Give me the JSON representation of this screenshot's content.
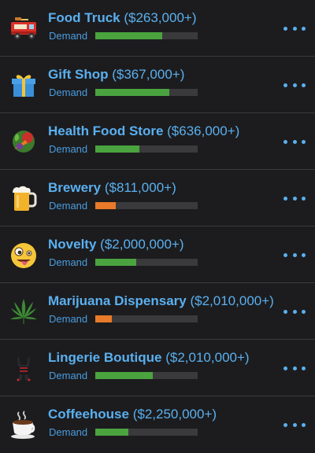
{
  "colors": {
    "accent": "#5ab0f0",
    "demand_high": "#4aa33f",
    "demand_low": "#e87a2a",
    "bar_track": "#3a3a3c"
  },
  "businesses": [
    {
      "name": "Food Truck",
      "price": "($263,000+)",
      "demand_label": "Demand",
      "demand": 0.65,
      "demand_color": "#4aa33f",
      "icon": "food-truck-icon"
    },
    {
      "name": "Gift Shop",
      "price": "($367,000+)",
      "demand_label": "Demand",
      "demand": 0.72,
      "demand_color": "#4aa33f",
      "icon": "gift-icon"
    },
    {
      "name": "Health Food Store",
      "price": "($636,000+)",
      "demand_label": "Demand",
      "demand": 0.43,
      "demand_color": "#4aa33f",
      "icon": "vegetables-icon"
    },
    {
      "name": "Brewery",
      "price": "($811,000+)",
      "demand_label": "Demand",
      "demand": 0.2,
      "demand_color": "#e87a2a",
      "icon": "beer-mug-icon"
    },
    {
      "name": "Novelty",
      "price": "($2,000,000+)",
      "demand_label": "Demand",
      "demand": 0.4,
      "demand_color": "#4aa33f",
      "icon": "zany-face-icon"
    },
    {
      "name": "Marijuana Dispensary",
      "price": "($2,010,000+)",
      "demand_label": "Demand",
      "demand": 0.16,
      "demand_color": "#e87a2a",
      "icon": "cannabis-leaf-icon"
    },
    {
      "name": "Lingerie Boutique",
      "price": "($2,010,000+)",
      "demand_label": "Demand",
      "demand": 0.56,
      "demand_color": "#4aa33f",
      "icon": "lingerie-icon"
    },
    {
      "name": "Coffeehouse",
      "price": "($2,250,000+)",
      "demand_label": "Demand",
      "demand": 0.32,
      "demand_color": "#4aa33f",
      "icon": "coffee-cup-icon"
    }
  ]
}
